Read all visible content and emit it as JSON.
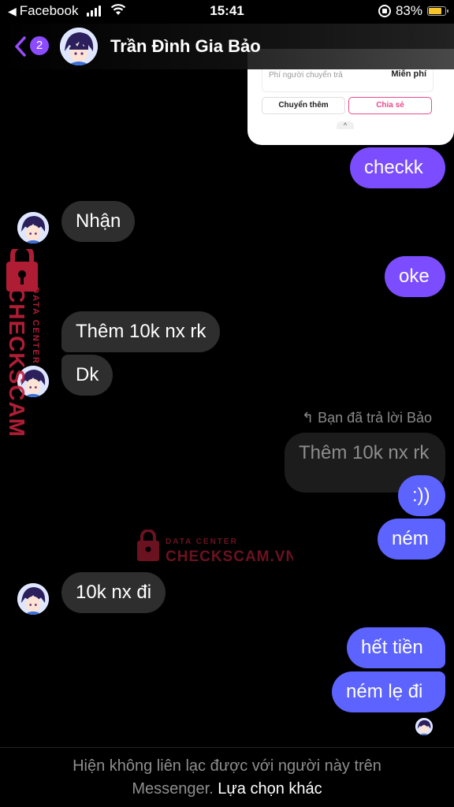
{
  "status_bar": {
    "back_app": "Facebook",
    "time": "15:41",
    "battery": "83%",
    "battery_level": 0.83
  },
  "header": {
    "back_count": "2",
    "contact_name": "Trần Đình Gia Bảo"
  },
  "shared_card": {
    "fee_label": "Phí người chuyển trả",
    "fee_value": "Miễn phí",
    "button_transfer_more": "Chuyển thêm",
    "button_share": "Chia sẻ"
  },
  "messages": {
    "m1": "checkk",
    "m2": "Nhận",
    "m3": "oke",
    "m4": "Thêm 10k nx rk",
    "m5": "Dk",
    "reply_label": "Bạn đã trả lời Bảo",
    "quoted": "Thêm 10k nx rk",
    "m6": ":))",
    "m7": "ném",
    "m8": "10k nx đi",
    "m9": "hết tiền",
    "m10": "ném lẹ đi"
  },
  "watermark": {
    "line1": "DATA CENTER",
    "line2": "CHECKSCAM.VN"
  },
  "footer": {
    "text": "Hiện không liên lạc được với người này trên Messenger.",
    "text_line1": "Hiện không liên lạc được với người này trên",
    "text_line2": "Messenger.",
    "link": "Lựa chọn khác"
  },
  "colors": {
    "sent_purple": "#7b4dff",
    "sent_blue": "#5c63ff",
    "received": "#2e2e2e",
    "accent": "#8c4bff",
    "watermark": "#c3213b"
  }
}
